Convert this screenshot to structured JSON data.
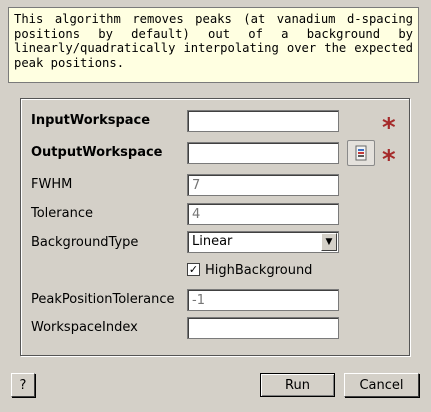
{
  "description": "This algorithm removes peaks (at vanadium d-spacing positions by default) out of a background by linearly/quadratically interpolating over the expected peak positions.",
  "fields": {
    "input_workspace": {
      "label": "InputWorkspace",
      "value": ""
    },
    "output_workspace": {
      "label": "OutputWorkspace",
      "value": ""
    },
    "fwhm": {
      "label": "FWHM",
      "placeholder": "7"
    },
    "tolerance": {
      "label": "Tolerance",
      "placeholder": "4"
    },
    "background_type": {
      "label": "BackgroundType",
      "selected": "Linear"
    },
    "high_background": {
      "label": "HighBackground",
      "checked": true
    },
    "peak_position_tolerance": {
      "label": "PeakPositionTolerance",
      "placeholder": "-1"
    },
    "workspace_index": {
      "label": "WorkspaceIndex",
      "value": ""
    }
  },
  "required_marker": "*",
  "buttons": {
    "help": "?",
    "run": "Run",
    "cancel": "Cancel"
  },
  "icons": {
    "browse": "workspace-browse-icon",
    "required": "required-star-icon"
  },
  "colors": {
    "tooltip_bg": "#ffffe1",
    "required": "#a52a2a",
    "dialog_bg": "#d4d0c8"
  }
}
